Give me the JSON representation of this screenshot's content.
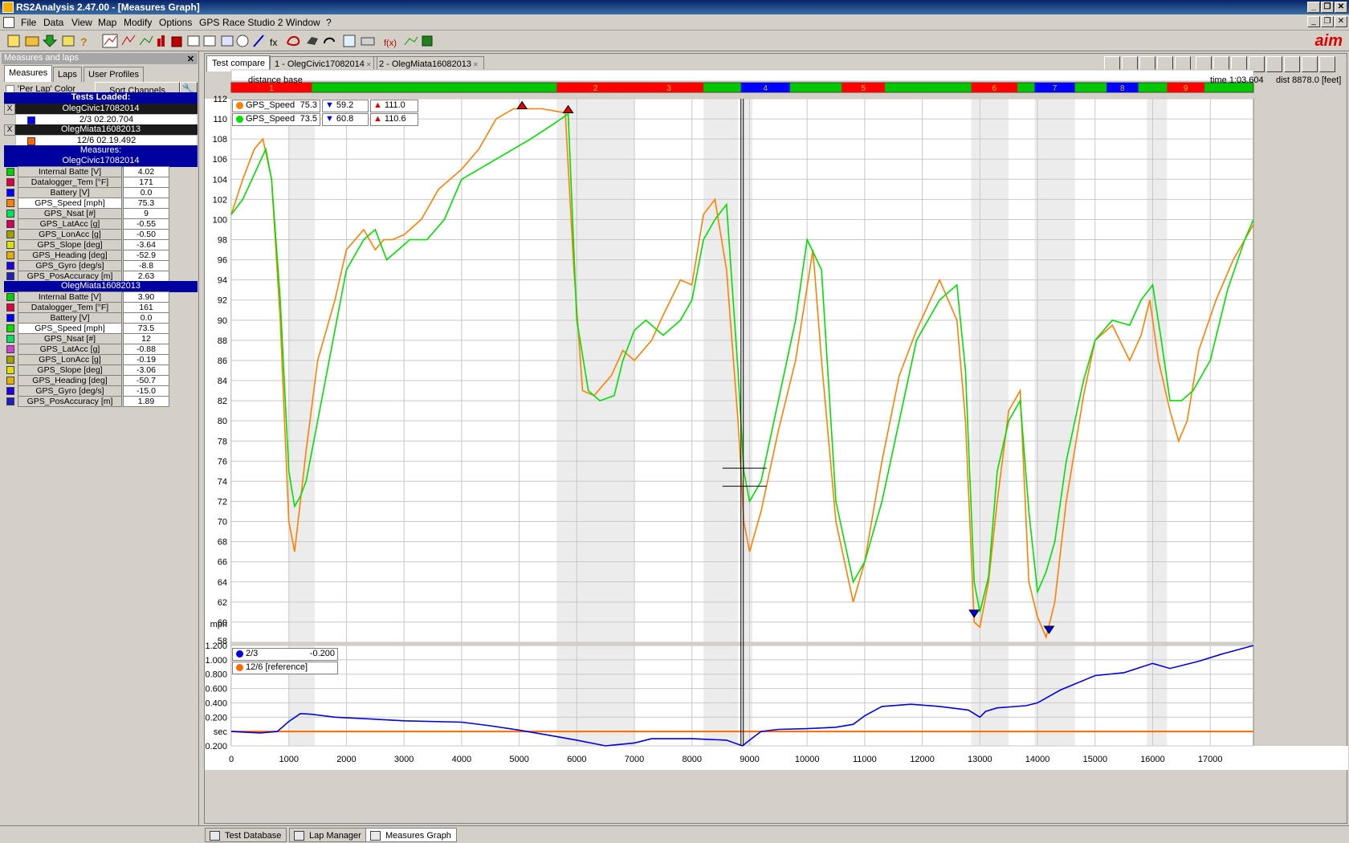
{
  "app": {
    "title": "RS2Analysis 2.47.00 - [Measures Graph]"
  },
  "menu": [
    "File",
    "Data",
    "View",
    "Map",
    "Modify",
    "Options",
    "GPS",
    "Race Studio 2",
    "Window",
    "?"
  ],
  "left_panel": {
    "title": "Measures and laps",
    "tabs": [
      "Measures",
      "Laps",
      "User Profiles"
    ],
    "per_lap_label": "'Per Lap' Color",
    "sort_button": "Sort Channels",
    "tests_loaded_label": "Tests Loaded:",
    "tests": [
      {
        "name": "OlegCivic17082014",
        "lap": "2/3 02.20.704",
        "color": "#0000ff"
      },
      {
        "name": "OlegMiata16082013",
        "lap": "12/6 02.19.492",
        "color": "#ff6a00"
      }
    ],
    "measures_label": "Measures:",
    "groups": [
      {
        "name": "OlegCivic17082014",
        "channels": [
          {
            "name": "Internal Batte",
            "unit": "[V]",
            "value": "4.02",
            "color": "#00d000"
          },
          {
            "name": "Datalogger_Tem",
            "unit": "[°F]",
            "value": "171",
            "color": "#e00040"
          },
          {
            "name": "Battery",
            "unit": "[V]",
            "value": "0.0",
            "color": "#0000ff"
          },
          {
            "name": "GPS_Speed",
            "unit": "[mph]",
            "value": "75.3",
            "color": "#ff8000",
            "selected": true
          },
          {
            "name": "GPS_Nsat",
            "unit": "[#]",
            "value": "9",
            "color": "#00e060"
          },
          {
            "name": "GPS_LatAcc",
            "unit": "[g]",
            "value": "-0.55",
            "color": "#d00060"
          },
          {
            "name": "GPS_LonAcc",
            "unit": "[g]",
            "value": "-0.50",
            "color": "#a0a000"
          },
          {
            "name": "GPS_Slope",
            "unit": "[deg]",
            "value": "-3.64",
            "color": "#e0e000"
          },
          {
            "name": "GPS_Heading",
            "unit": "[deg]",
            "value": "-52.9",
            "color": "#e0b000"
          },
          {
            "name": "GPS_Gyro",
            "unit": "[deg/s]",
            "value": "-8.8",
            "color": "#2000e0"
          },
          {
            "name": "GPS_PosAccuracy",
            "unit": "[m]",
            "value": "2.63",
            "color": "#2020c0"
          }
        ]
      },
      {
        "name": "OlegMiata16082013",
        "channels": [
          {
            "name": "Internal Batte",
            "unit": "[V]",
            "value": "3.90",
            "color": "#00d000"
          },
          {
            "name": "Datalogger_Tem",
            "unit": "[°F]",
            "value": "161",
            "color": "#e00040"
          },
          {
            "name": "Battery",
            "unit": "[V]",
            "value": "0.0",
            "color": "#0000ff"
          },
          {
            "name": "GPS_Speed",
            "unit": "[mph]",
            "value": "73.5",
            "color": "#00e000",
            "selected": true
          },
          {
            "name": "GPS_Nsat",
            "unit": "[#]",
            "value": "12",
            "color": "#00e060"
          },
          {
            "name": "GPS_LatAcc",
            "unit": "[g]",
            "value": "-0.88",
            "color": "#d040d0"
          },
          {
            "name": "GPS_LonAcc",
            "unit": "[g]",
            "value": "-0.19",
            "color": "#a0a000"
          },
          {
            "name": "GPS_Slope",
            "unit": "[deg]",
            "value": "-3.06",
            "color": "#e0e000"
          },
          {
            "name": "GPS_Heading",
            "unit": "[deg]",
            "value": "-50.7",
            "color": "#e0b000"
          },
          {
            "name": "GPS_Gyro",
            "unit": "[deg/s]",
            "value": "-15.0",
            "color": "#2000e0"
          },
          {
            "name": "GPS_PosAccuracy",
            "unit": "[m]",
            "value": "1.89",
            "color": "#2020c0"
          }
        ]
      }
    ]
  },
  "graph_tabs": [
    "Test compare",
    "1 - OlegCivic17082014",
    "2 - OlegMiata16082013"
  ],
  "graph": {
    "base_label": "distance base",
    "time_readout": "time 1:03.604",
    "dist_readout": "dist 8878.0 [feet]",
    "legend": [
      {
        "name": "GPS_Speed",
        "value": "75.3",
        "min": "59.2",
        "max": "111.0",
        "color": "#ff8000"
      },
      {
        "name": "GPS_Speed",
        "value": "73.5",
        "min": "60.8",
        "max": "110.6",
        "color": "#00e000"
      }
    ],
    "delta_legend": [
      {
        "name": "2/3",
        "value": "-0.200",
        "color": "#0000e0"
      },
      {
        "name": "12/6 [reference]",
        "value": "",
        "color": "#ff6a00"
      }
    ],
    "sectors": [
      {
        "label": "1",
        "start": 0,
        "end": 1400,
        "color": "#ff0000"
      },
      {
        "label": "2",
        "start": 5650,
        "end": 7000,
        "color": "#ff0000"
      },
      {
        "label": "3",
        "start": 7000,
        "end": 8200,
        "color": "#ff0000"
      },
      {
        "label": "4",
        "start": 8850,
        "end": 9700,
        "color": "#0000ff"
      },
      {
        "label": "5",
        "start": 10600,
        "end": 11350,
        "color": "#ff0000"
      },
      {
        "label": "6",
        "start": 12850,
        "end": 13650,
        "color": "#ff0000"
      },
      {
        "label": "7",
        "start": 13950,
        "end": 14650,
        "color": "#0000ff"
      },
      {
        "label": "8",
        "start": 15200,
        "end": 15750,
        "color": "#0000ff"
      },
      {
        "label": "9",
        "start": 16250,
        "end": 16900,
        "color": "#ff0000"
      }
    ]
  },
  "chart_data": {
    "type": "line",
    "xlabel": "",
    "ylabel": "mph",
    "xlim": [
      0,
      17750
    ],
    "ylim": [
      58,
      112
    ],
    "x_ticks": [
      0,
      1000,
      2000,
      3000,
      4000,
      5000,
      6000,
      7000,
      8000,
      9000,
      10000,
      11000,
      12000,
      13000,
      14000,
      15000,
      16000,
      17000
    ],
    "y_ticks": [
      58,
      60,
      62,
      64,
      66,
      68,
      70,
      72,
      74,
      76,
      78,
      80,
      82,
      84,
      86,
      88,
      90,
      92,
      94,
      96,
      98,
      100,
      102,
      104,
      106,
      108,
      110,
      112
    ],
    "series": [
      {
        "name": "GPS_Speed",
        "color": "#ff8000",
        "x": [
          0,
          200,
          400,
          550,
          700,
          850,
          1000,
          1100,
          1200,
          1300,
          1500,
          1800,
          2000,
          2300,
          2500,
          2650,
          2800,
          3000,
          3300,
          3600,
          4000,
          4300,
          4600,
          4900,
          5050,
          5400,
          5800,
          5950,
          6100,
          6300,
          6600,
          6800,
          7000,
          7150,
          7300,
          7500,
          7800,
          8000,
          8200,
          8400,
          8600,
          8800,
          8900,
          9000,
          9200,
          9500,
          9800,
          10100,
          10250,
          10500,
          10800,
          11000,
          11300,
          11600,
          11900,
          12300,
          12600,
          12750,
          12900,
          13000,
          13150,
          13300,
          13500,
          13700,
          13850,
          14000,
          14150,
          14300,
          14500,
          14800,
          15000,
          15300,
          15600,
          15800,
          15950,
          16100,
          16300,
          16450,
          16600,
          16800,
          17100,
          17400,
          17750
        ],
        "values": [
          100.5,
          104,
          107,
          108,
          104,
          90,
          70,
          67,
          72,
          77,
          86,
          92,
          97,
          99,
          97,
          98,
          98,
          98.5,
          100,
          103,
          105,
          107,
          110,
          111,
          111,
          111,
          110.6,
          95,
          83,
          82.5,
          84.5,
          87,
          86,
          87,
          88,
          90.5,
          94,
          93.5,
          100.5,
          102,
          95,
          80,
          70,
          67,
          71,
          79,
          86,
          97,
          86,
          70,
          62,
          66,
          76,
          84.5,
          89,
          94,
          90,
          80,
          60,
          59.5,
          64,
          72,
          81,
          83,
          64,
          60.5,
          58.5,
          62,
          72,
          82.5,
          88,
          89.5,
          86,
          88.5,
          92,
          86,
          81,
          78,
          80,
          87,
          92,
          96,
          99.5
        ]
      },
      {
        "name": "GPS_Speed",
        "color": "#00e000",
        "x": [
          0,
          200,
          400,
          600,
          700,
          850,
          1000,
          1100,
          1200,
          1300,
          1500,
          1800,
          2000,
          2300,
          2500,
          2700,
          2900,
          3100,
          3400,
          3700,
          4000,
          4300,
          4600,
          4900,
          5200,
          5600,
          5850,
          6000,
          6200,
          6400,
          6650,
          6800,
          7000,
          7200,
          7500,
          7800,
          8000,
          8200,
          8400,
          8600,
          8800,
          8900,
          9000,
          9200,
          9500,
          9800,
          10000,
          10250,
          10500,
          10800,
          11000,
          11300,
          11600,
          11900,
          12300,
          12600,
          12750,
          12900,
          13000,
          13150,
          13300,
          13500,
          13700,
          13850,
          14000,
          14150,
          14300,
          14500,
          14800,
          15000,
          15300,
          15600,
          15800,
          16000,
          16150,
          16300,
          16500,
          16700,
          17000,
          17300,
          17600,
          17750
        ],
        "values": [
          100.5,
          102,
          104.5,
          107,
          104,
          92,
          75,
          71.5,
          72.5,
          74,
          80,
          89,
          95,
          98,
          99,
          96,
          97,
          98,
          98,
          100,
          104,
          105,
          106,
          107,
          108,
          109.5,
          110.5,
          90,
          83,
          82,
          82.5,
          86,
          89,
          90,
          88.5,
          90,
          92,
          98,
          100,
          101.5,
          85,
          75,
          72,
          74,
          82,
          90,
          98,
          95,
          72,
          64,
          66,
          72,
          80,
          88,
          92,
          93.5,
          85,
          64,
          61,
          64.5,
          75,
          80,
          82,
          71,
          63,
          65,
          68,
          76,
          84,
          88,
          90,
          89.5,
          92,
          93.5,
          88,
          82,
          82,
          83,
          86,
          93,
          98,
          100
        ]
      },
      {
        "name": "2/3",
        "color": "#0000e0",
        "x": [
          0,
          500,
          800,
          1000,
          1200,
          1400,
          1800,
          2300,
          3000,
          4000,
          4500,
          5000,
          5500,
          6000,
          6500,
          7000,
          7300,
          8000,
          8600,
          8878,
          9000,
          9200,
          9500,
          10000,
          10500,
          10800,
          11000,
          11300,
          11800,
          12300,
          12800,
          13000,
          13100,
          13300,
          13800,
          14000,
          14400,
          15000,
          15500,
          16000,
          16300,
          16800,
          17200,
          17750
        ],
        "values": [
          0.0,
          -0.02,
          0.0,
          0.14,
          0.25,
          0.24,
          0.2,
          0.18,
          0.15,
          0.13,
          0.08,
          0.02,
          -0.05,
          -0.12,
          -0.2,
          -0.16,
          -0.1,
          -0.1,
          -0.12,
          -0.2,
          -0.12,
          0.0,
          0.03,
          0.04,
          0.06,
          0.1,
          0.22,
          0.35,
          0.38,
          0.35,
          0.3,
          0.2,
          0.28,
          0.33,
          0.36,
          0.4,
          0.58,
          0.78,
          0.82,
          0.95,
          0.88,
          0.98,
          1.08,
          1.2
        ]
      },
      {
        "name": "12/6 [reference]",
        "color": "#ff6a00",
        "x": [
          0,
          17750
        ],
        "values": [
          0.0,
          0.0
        ]
      }
    ],
    "delta_ylim": [
      -0.2,
      1.2
    ],
    "delta_ticks": [
      -0.2,
      0.0,
      0.2,
      0.4,
      0.6,
      0.8,
      1.0,
      1.2
    ],
    "delta_ylabel": "sec",
    "min_markers": [
      {
        "x": 12900,
        "y": 60.8
      },
      {
        "x": 14200,
        "y": 59.2
      }
    ],
    "max_markers": [
      {
        "x": 5050,
        "y": 111.0
      },
      {
        "x": 5850,
        "y": 110.6
      }
    ],
    "cursor_x": 8878,
    "shaded_bands": [
      [
        1000,
        1450
      ],
      [
        5650,
        7000
      ],
      [
        8200,
        8800
      ],
      [
        8850,
        9050
      ],
      [
        12850,
        13500
      ],
      [
        13950,
        14650
      ],
      [
        15900,
        16250
      ]
    ],
    "grid": true
  },
  "bottom_tabs": [
    "Test Database",
    "Lap Manager",
    "Measures Graph"
  ]
}
